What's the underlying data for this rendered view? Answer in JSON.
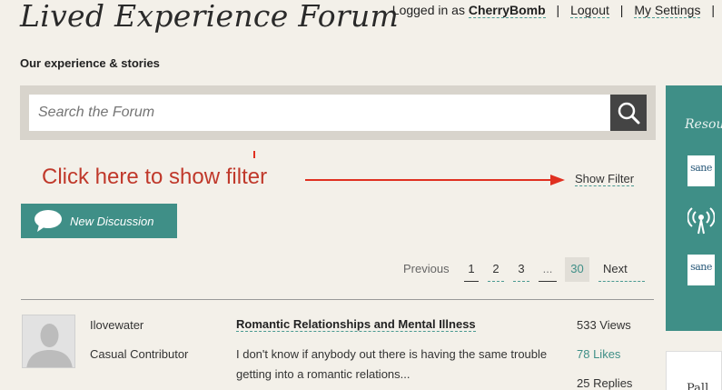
{
  "header": {
    "site_title": "Lived Experience Forum",
    "subtitle": "Our experience & stories",
    "logged_in_prefix": "Logged in as",
    "username": "CherryBomb",
    "logout": "Logout",
    "my_settings": "My Settings",
    "separator": "|"
  },
  "search": {
    "placeholder": "Search the Forum",
    "icon": "search-icon"
  },
  "annotation": {
    "text": "Click here to show filter",
    "color": "#c0392b"
  },
  "filter": {
    "show_filter_label": "Show Filter"
  },
  "actions": {
    "new_discussion": "New Discussion",
    "icon": "speech-bubble-icon"
  },
  "pagination": {
    "previous": "Previous",
    "pages": [
      "1",
      "2",
      "3",
      "...",
      "30"
    ],
    "current": "30",
    "next": "Next"
  },
  "discussions": [
    {
      "author": "Ilovewater",
      "rank": "Casual Contributor",
      "title": "Romantic Relationships and Mental Illness",
      "excerpt": " I don't know if anybody out there is having the same trouble getting into a romantic relations...",
      "views": "533 Views",
      "likes": "78 Likes",
      "replies": "25 Replies"
    }
  ],
  "sidebar": {
    "title": "Resou",
    "logo_text": "sane",
    "card_text": "Pall",
    "icons": [
      "sane-logo-icon",
      "broadcast-icon",
      "sane-logo-icon"
    ]
  },
  "colors": {
    "accent": "#3f8f87",
    "background": "#f3f0e9"
  }
}
